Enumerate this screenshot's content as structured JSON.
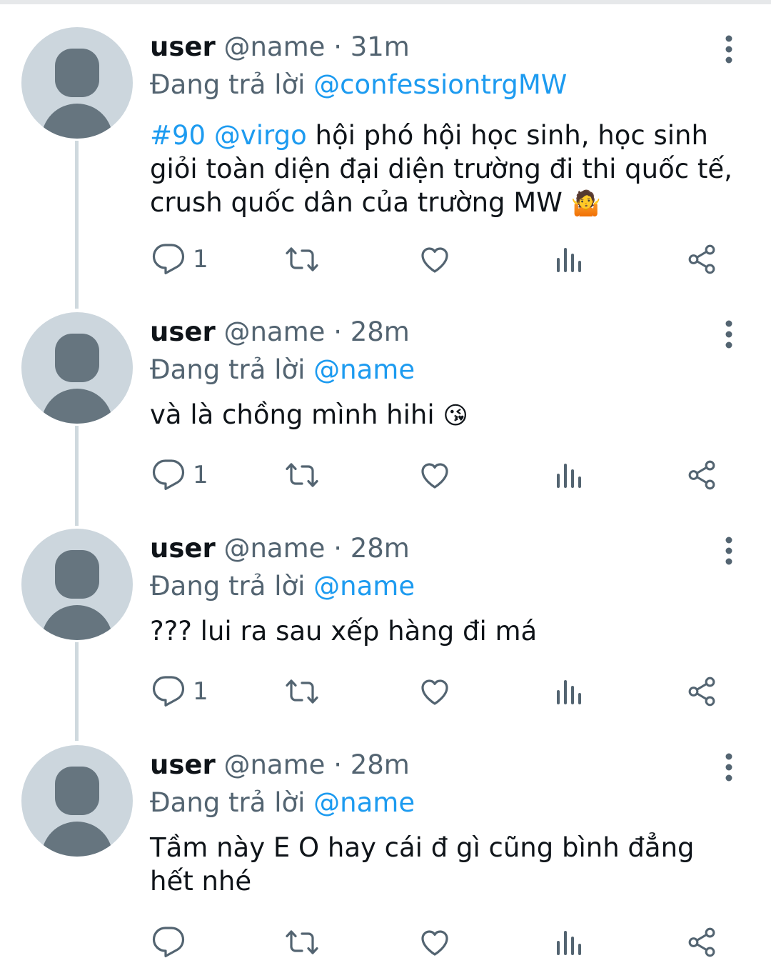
{
  "colors": {
    "link": "#1d9bf0",
    "secondary_text": "#536471",
    "thread_line": "#cfd9de",
    "avatar_bg": "#ccd6dd",
    "avatar_fg": "#66757f"
  },
  "tweets": [
    {
      "display_name": "user",
      "handle": "@name",
      "separator": "·",
      "time": "31m",
      "reply_prefix": "Đang trả lời",
      "reply_to": "@confessiontrgMW",
      "hashtag": "#90",
      "mention": "@virgo",
      "text": "hội phó hội học sinh, học sinh giỏi toàn diện đại diện trường đi thi quốc tế, crush quốc dân của trường MW",
      "emoji": "🤷",
      "reply_count": "1"
    },
    {
      "display_name": "user",
      "handle": "@name",
      "separator": "·",
      "time": "28m",
      "reply_prefix": "Đang trả lời",
      "reply_to": "@name",
      "text": "và là chồng mình hihi",
      "emoji": "😘",
      "reply_count": "1"
    },
    {
      "display_name": "user",
      "handle": "@name",
      "separator": "·",
      "time": "28m",
      "reply_prefix": "Đang trả lời",
      "reply_to": "@name",
      "text": "??? lui ra sau xếp hàng đi má",
      "reply_count": "1"
    },
    {
      "display_name": "user",
      "handle": "@name",
      "separator": "·",
      "time": "28m",
      "reply_prefix": "Đang trả lời",
      "reply_to": "@name",
      "text": "Tầm này E O hay cái đ gì cũng bình đẳng hết nhé",
      "reply_count": ""
    }
  ],
  "icons": [
    "reply-icon",
    "retweet-icon",
    "like-icon",
    "views-icon",
    "share-icon",
    "more-options-icon"
  ]
}
